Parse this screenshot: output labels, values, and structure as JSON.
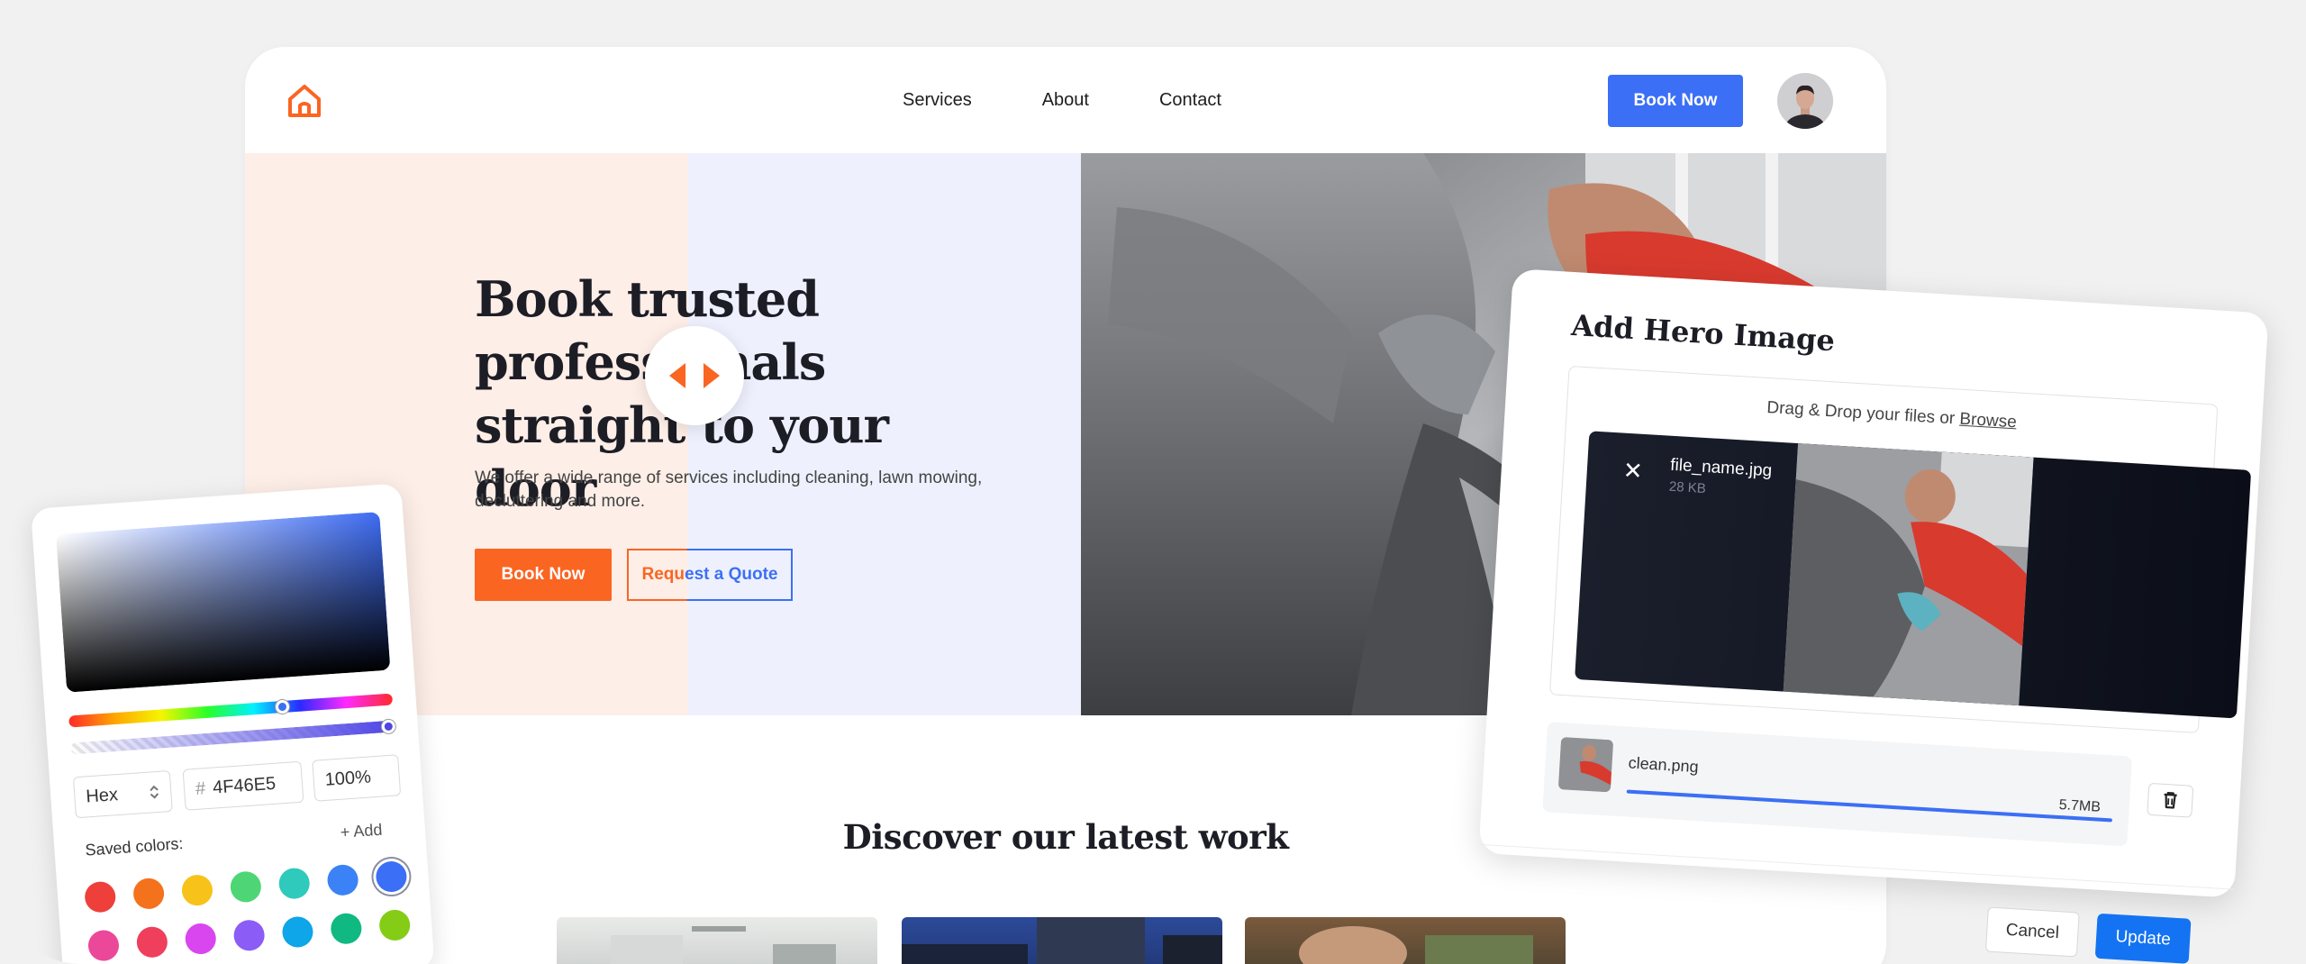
{
  "nav": {
    "links": [
      "Services",
      "About",
      "Contact"
    ],
    "book_label": "Book Now",
    "logo_icon": "house-icon",
    "avatar": "user-avatar"
  },
  "hero": {
    "title": "Book trusted professionals straight to your door",
    "subtitle": "We offer a wide range of services including cleaning, lawn mowing, decluttering and more.",
    "book_label": "Book Now",
    "quote_label": "Request a Quote",
    "compare_handle_icon": "compare-arrows-icon"
  },
  "discover": {
    "title": "Discover our latest work"
  },
  "color_picker": {
    "format": "Hex",
    "hex_symbol": "#",
    "hex_value": "4F46E5",
    "opacity": "100%",
    "saved_label": "Saved colors:",
    "add_label": "+ Add",
    "hue_position": 0.66,
    "alpha": 1.0,
    "swatches": [
      "#ee3f3a",
      "#f4721c",
      "#f7c21a",
      "#4ed676",
      "#2fcabb",
      "#3b82f6",
      "#3b6ff5",
      "#ec4899",
      "#ef3f5c",
      "#d946ef",
      "#8b5cf6",
      "#0ea5e9",
      "#10b981",
      "#84cc16"
    ],
    "selected_swatch": 6
  },
  "modal": {
    "title": "Add Hero Image",
    "dropzone_text": "Drag & Drop your files or",
    "browse_label": "Browse",
    "file": {
      "name": "file_name.jpg",
      "size": "28 KB"
    },
    "upload": {
      "name": "clean.png",
      "size": "5.7MB",
      "progress": 1.0
    },
    "cancel_label": "Cancel",
    "update_label": "Update"
  },
  "colors": {
    "accent_orange": "#fa6522",
    "accent_blue": "#3b6ff5",
    "update_blue": "#1473f2"
  }
}
